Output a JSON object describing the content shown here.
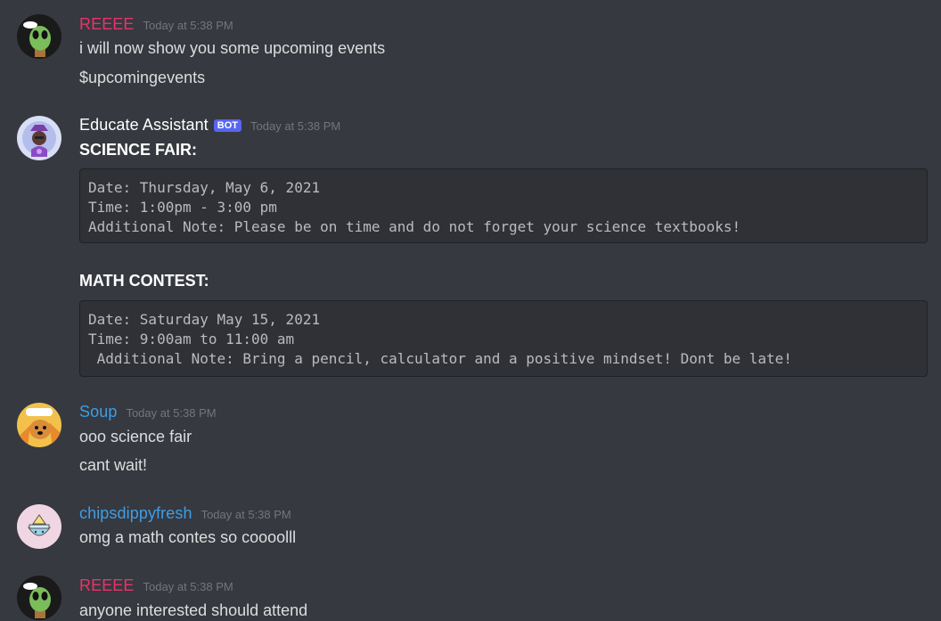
{
  "messages": [
    {
      "username": "REEEE",
      "username_color": "#e9336b",
      "timestamp": "Today at 5:38 PM",
      "avatar": "alien-avatar",
      "lines": [
        "i will now show you some upcoming events",
        "$upcomingevents"
      ]
    },
    {
      "username": "Educate Assistant",
      "username_color": "#ffffff",
      "bot_tag": "BOT",
      "timestamp": "Today at 5:38 PM",
      "avatar": "wizard-bot-avatar",
      "sections": [
        {
          "heading": "SCIENCE FAIR:",
          "code": "Date: Thursday, May 6, 2021\nTime: 1:00pm - 3:00 pm\nAdditional Note: Please be on time and do not forget your science textbooks!"
        },
        {
          "heading": "MATH CONTEST:",
          "code": "Date: Saturday May 15, 2021\nTime: 9:00am to 11:00 am\n Additional Note: Bring a pencil, calculator and a positive mindset! Dont be late!"
        }
      ]
    },
    {
      "username": "Soup",
      "username_color": "#3d9ee6",
      "timestamp": "Today at 5:38 PM",
      "avatar": "dog-avatar",
      "lines": [
        "ooo science fair",
        "cant wait!"
      ]
    },
    {
      "username": "chipsdippyfresh",
      "username_color": "#3d9ee6",
      "timestamp": "Today at 5:38 PM",
      "avatar": "chips-bowl-avatar",
      "lines": [
        "omg a math contes so coooolll"
      ]
    },
    {
      "username": "REEEE",
      "username_color": "#e9336b",
      "timestamp": "Today at 5:38 PM",
      "avatar": "alien-avatar",
      "lines": [
        "anyone interested should attend"
      ]
    }
  ],
  "colors": {
    "background": "#36393f",
    "code_background": "#2f3136",
    "bot_tag": "#5865f2",
    "timestamp": "#72767d"
  }
}
